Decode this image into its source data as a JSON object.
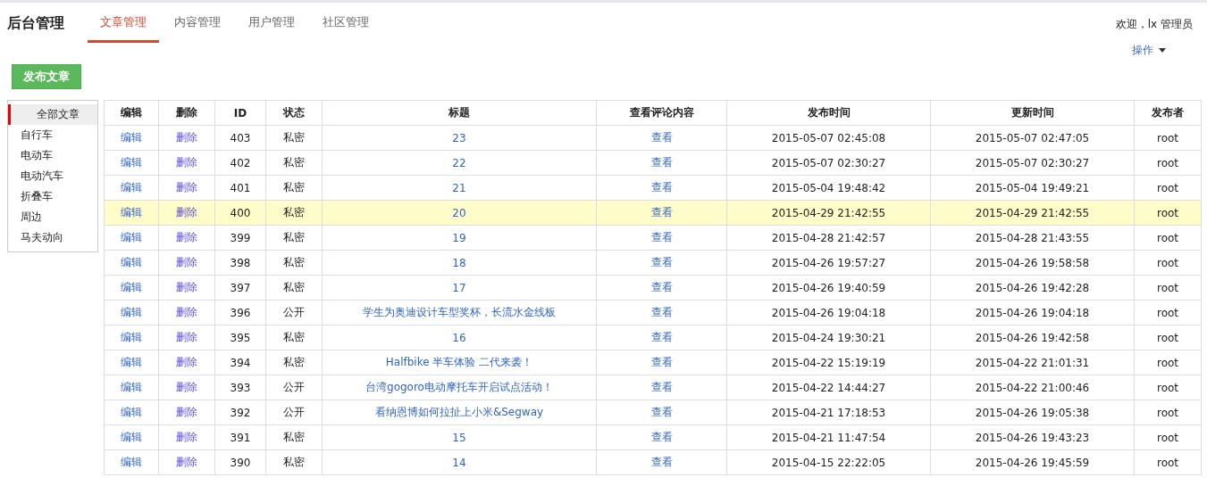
{
  "brand": "后台管理",
  "nav": [
    {
      "label": "文章管理",
      "selected": true
    },
    {
      "label": "内容管理",
      "selected": false
    },
    {
      "label": "用户管理",
      "selected": false
    },
    {
      "label": "社区管理",
      "selected": false
    }
  ],
  "welcome": "欢迎，lx 管理员",
  "actions_menu": "操作",
  "publish_button": "发布文章",
  "category_menu": [
    {
      "label": "全部文章",
      "selected": true
    },
    {
      "label": "自行车",
      "selected": false
    },
    {
      "label": "电动车",
      "selected": false
    },
    {
      "label": "电动汽车",
      "selected": false
    },
    {
      "label": "折叠车",
      "selected": false
    },
    {
      "label": "周边",
      "selected": false
    },
    {
      "label": "马夫动向",
      "selected": false
    }
  ],
  "table": {
    "columns": [
      "编辑",
      "删除",
      "ID",
      "状态",
      "标题",
      "查看评论内容",
      "发布时间",
      "更新时间",
      "发布者"
    ],
    "rows": [
      {
        "edit": "编辑",
        "delete": "删除",
        "id": "403",
        "status": "私密",
        "title": "23",
        "comments": "查看",
        "published": "2015-05-07 02:45:08",
        "updated": "2015-05-07 02:47:05",
        "author": "root",
        "selected": false
      },
      {
        "edit": "编辑",
        "delete": "删除",
        "id": "402",
        "status": "私密",
        "title": "22",
        "comments": "查看",
        "published": "2015-05-07 02:30:27",
        "updated": "2015-05-07 02:30:27",
        "author": "root",
        "selected": false
      },
      {
        "edit": "编辑",
        "delete": "删除",
        "id": "401",
        "status": "私密",
        "title": "21",
        "comments": "查看",
        "published": "2015-05-04 19:48:42",
        "updated": "2015-05-04 19:49:21",
        "author": "root",
        "selected": false
      },
      {
        "edit": "编辑",
        "delete": "删除",
        "id": "400",
        "status": "私密",
        "title": "20",
        "comments": "查看",
        "published": "2015-04-29 21:42:55",
        "updated": "2015-04-29 21:42:55",
        "author": "root",
        "selected": true
      },
      {
        "edit": "编辑",
        "delete": "删除",
        "id": "399",
        "status": "私密",
        "title": "19",
        "comments": "查看",
        "published": "2015-04-28 21:42:57",
        "updated": "2015-04-28 21:43:55",
        "author": "root",
        "selected": false
      },
      {
        "edit": "编辑",
        "delete": "删除",
        "id": "398",
        "status": "私密",
        "title": "18",
        "comments": "查看",
        "published": "2015-04-26 19:57:27",
        "updated": "2015-04-26 19:58:58",
        "author": "root",
        "selected": false
      },
      {
        "edit": "编辑",
        "delete": "删除",
        "id": "397",
        "status": "私密",
        "title": "17",
        "comments": "查看",
        "published": "2015-04-26 19:40:59",
        "updated": "2015-04-26 19:42:28",
        "author": "root",
        "selected": false
      },
      {
        "edit": "编辑",
        "delete": "删除",
        "id": "396",
        "status": "公开",
        "title": "学生为奥迪设计车型奖杯，长流水金线板",
        "comments": "查看",
        "published": "2015-04-26 19:04:18",
        "updated": "2015-04-26 19:04:18",
        "author": "root",
        "selected": false
      },
      {
        "edit": "编辑",
        "delete": "删除",
        "id": "395",
        "status": "私密",
        "title": "16",
        "comments": "查看",
        "published": "2015-04-24 19:30:21",
        "updated": "2015-04-26 19:42:58",
        "author": "root",
        "selected": false
      },
      {
        "edit": "编辑",
        "delete": "删除",
        "id": "394",
        "status": "私密",
        "title": "Halfbike 半车体验 二代来袭！",
        "comments": "查看",
        "published": "2015-04-22 15:19:19",
        "updated": "2015-04-22 21:01:31",
        "author": "root",
        "selected": false
      },
      {
        "edit": "编辑",
        "delete": "删除",
        "id": "393",
        "status": "公开",
        "title": "台湾gogoro电动摩托车开启试点活动！",
        "comments": "查看",
        "published": "2015-04-22 14:44:27",
        "updated": "2015-04-22 21:00:46",
        "author": "root",
        "selected": false
      },
      {
        "edit": "编辑",
        "delete": "删除",
        "id": "392",
        "status": "公开",
        "title": "看纳恩博如何拉扯上小米&Segway",
        "comments": "查看",
        "published": "2015-04-21 17:18:53",
        "updated": "2015-04-26 19:05:38",
        "author": "root",
        "selected": false
      },
      {
        "edit": "编辑",
        "delete": "删除",
        "id": "391",
        "status": "私密",
        "title": "15",
        "comments": "查看",
        "published": "2015-04-21 11:47:54",
        "updated": "2015-04-26 19:43:23",
        "author": "root",
        "selected": false
      },
      {
        "edit": "编辑",
        "delete": "删除",
        "id": "390",
        "status": "私密",
        "title": "14",
        "comments": "查看",
        "published": "2015-04-15 22:22:05",
        "updated": "2015-04-26 19:45:59",
        "author": "root",
        "selected": false
      }
    ]
  }
}
